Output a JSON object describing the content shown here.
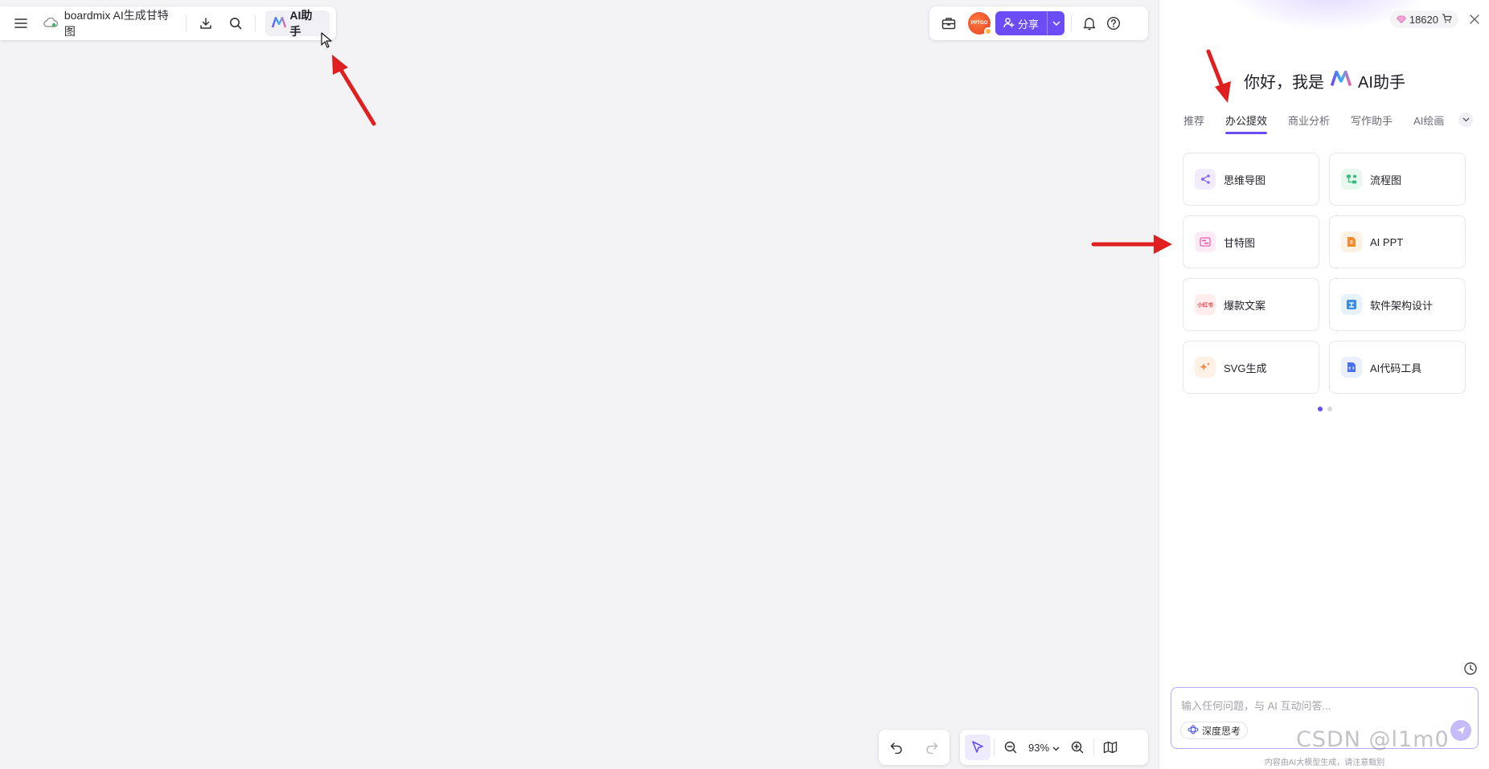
{
  "document": {
    "title": "boardmix AI生成甘特图"
  },
  "toolbar_left": {
    "ai_button_label": "AI助手"
  },
  "toolbar_right": {
    "avatar_text": "PPTGO",
    "share_label": "分享"
  },
  "bottom_toolbar": {
    "zoom_level": "93%"
  },
  "panel": {
    "credits": "18620",
    "greeting_prefix": "你好，我是",
    "greeting_name": "AI助手",
    "tabs": [
      {
        "label": "推荐",
        "active": false
      },
      {
        "label": "办公提效",
        "active": true
      },
      {
        "label": "商业分析",
        "active": false
      },
      {
        "label": "写作助手",
        "active": false
      },
      {
        "label": "AI绘画",
        "active": false
      }
    ],
    "cards": [
      {
        "label": "思维导图",
        "icon": "mindmap-icon",
        "color": "#8b6cf6",
        "bg": "#f1edff"
      },
      {
        "label": "流程图",
        "icon": "flowchart-icon",
        "color": "#2fbf7a",
        "bg": "#e8f8ef"
      },
      {
        "label": "甘特图",
        "icon": "gantt-icon",
        "color": "#ec5fb0",
        "bg": "#fdecf5"
      },
      {
        "label": "AI PPT",
        "icon": "ppt-icon",
        "color": "#f58a2e",
        "bg": "#fff1e4"
      },
      {
        "label": "爆款文案",
        "icon": "xiaohongshu-icon",
        "color": "#f0414b",
        "bg": "#ffecec"
      },
      {
        "label": "软件架构设计",
        "icon": "architecture-icon",
        "color": "#3a8ee6",
        "bg": "#e8f2fd"
      },
      {
        "label": "SVG生成",
        "icon": "sparkle-icon",
        "color": "#f5863c",
        "bg": "#fff1e6"
      },
      {
        "label": "AI代码工具",
        "icon": "code-icon",
        "color": "#4a6ff0",
        "bg": "#eaf0ff"
      }
    ],
    "xiaohongshu_badge": "小红书",
    "input_placeholder": "输入任何问题，与 AI 互动问答...",
    "deep_think_label": "深度思考",
    "disclaimer": "内容由AI大模型生成，请注意甄别"
  },
  "watermark": "CSDN @l1m0"
}
